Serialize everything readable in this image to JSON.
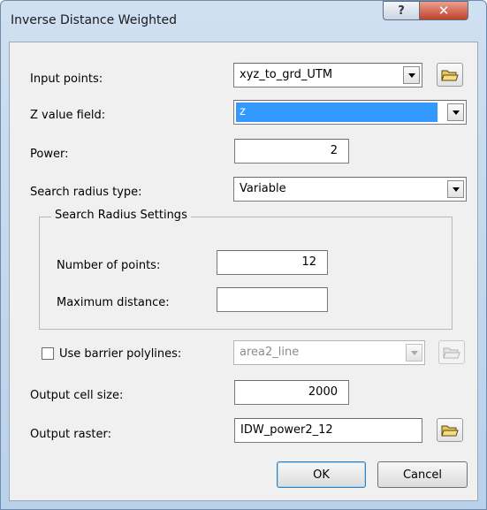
{
  "window": {
    "title": "Inverse Distance Weighted",
    "help_label": "?",
    "close_label": "✕"
  },
  "form": {
    "input_points": {
      "label": "Input points:",
      "value": "xyz_to_grd_UTM"
    },
    "z_value_field": {
      "label": "Z value field:",
      "value": "z"
    },
    "power": {
      "label": "Power:",
      "value": "2"
    },
    "search_radius_type": {
      "label": "Search radius type:",
      "value": "Variable"
    },
    "search_radius_settings": {
      "title": "Search Radius Settings",
      "number_of_points": {
        "label": "Number of points:",
        "value": "12"
      },
      "maximum_distance": {
        "label": "Maximum distance:",
        "value": ""
      }
    },
    "barrier": {
      "label": "Use barrier polylines:",
      "checked": false,
      "value": "area2_line"
    },
    "output_cell_size": {
      "label": "Output cell size:",
      "value": "2000"
    },
    "output_raster": {
      "label": "Output raster:",
      "value": "IDW_power2_12"
    }
  },
  "buttons": {
    "ok": "OK",
    "cancel": "Cancel"
  },
  "icons": {
    "open_folder": "open-folder-icon",
    "dropdown": "chevron-down-icon"
  }
}
